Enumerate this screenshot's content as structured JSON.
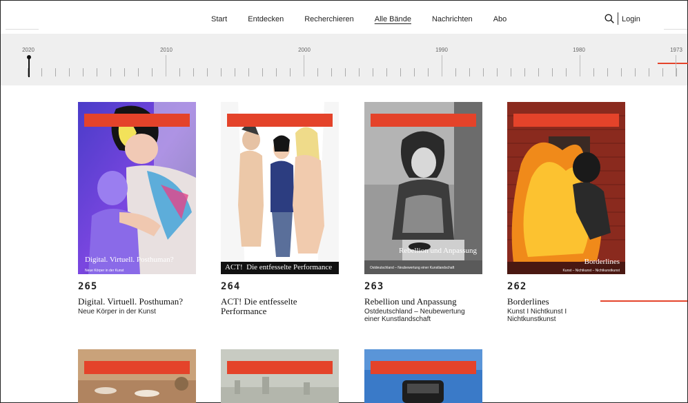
{
  "nav": {
    "items": [
      {
        "label": "Start",
        "active": false
      },
      {
        "label": "Entdecken",
        "active": false
      },
      {
        "label": "Recherchieren",
        "active": false
      },
      {
        "label": "Alle Bände",
        "active": true
      },
      {
        "label": "Nachrichten",
        "active": false
      },
      {
        "label": "Abo",
        "active": false
      }
    ],
    "login_label": "Login"
  },
  "timeline": {
    "years": [
      "2020",
      "2010",
      "2000",
      "1990",
      "1980",
      "1973"
    ]
  },
  "issues": [
    {
      "number": "265",
      "title": "Digital. Virtuell. Posthuman?",
      "subtitle": "Neue Körper in der Kunst",
      "cover_title": "Digital. Virtuell. Posthuman?",
      "cover_sub": "Neue Körper in der Kunst"
    },
    {
      "number": "264",
      "title": "ACT! Die entfesselte Performance",
      "subtitle": "",
      "cover_title": "ACT!  Die entfesselte Performance"
    },
    {
      "number": "263",
      "title": "Rebellion und Anpassung",
      "subtitle": "Ostdeutschland – Neubewertung einer Kunstlandschaft",
      "cover_title": "Rebellion und Anpassung",
      "cover_sub": "Ostdeutschland – Neubewertung einer Kunstlandschaft"
    },
    {
      "number": "262",
      "title": "Borderlines",
      "subtitle": "Kunst I Nichtkunst I Nichtkunstkunst",
      "cover_title": "Borderlines",
      "cover_sub": "Kunst – Nichtkunst – Nichtkunstkunst"
    }
  ],
  "colors": {
    "accent": "#e4432a",
    "timeline_bg": "#efefef"
  }
}
